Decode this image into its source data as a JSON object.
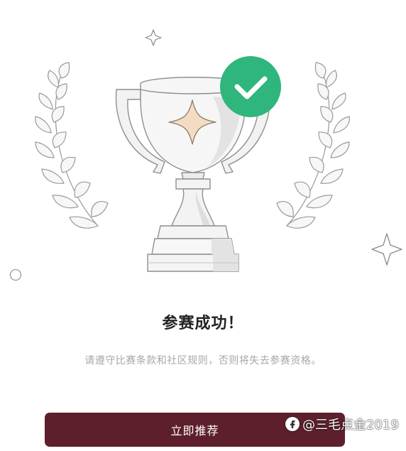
{
  "result": {
    "title": "参赛成功！",
    "message": "请遵守比赛条款和社区规则，否则将失去参赛资格。"
  },
  "actions": {
    "recommend_label": "立即推荐"
  },
  "watermark": {
    "text": "@三毛点金2019"
  },
  "icons": [
    "trophy-icon",
    "check-badge-icon",
    "laurel-left-icon",
    "laurel-right-icon",
    "sparkle-icon"
  ],
  "colors": {
    "primary": "#5e1f2c",
    "success": "#2eb67d",
    "star": "#f4dcc2"
  }
}
